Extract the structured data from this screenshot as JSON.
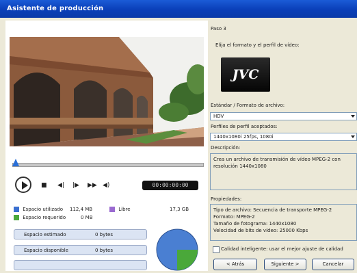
{
  "window": {
    "title": "Asistente de producción"
  },
  "step": {
    "label": "Paso 3",
    "instruction": "Elija el formato y el perfil de vídeo:"
  },
  "logo": {
    "text": "JVC"
  },
  "format": {
    "label": "Estándar / Formato de archivo:",
    "value": "HDV"
  },
  "profile": {
    "label": "Perfiles de perfil aceptados:",
    "value": "1440x1080i 25fps, 1080i"
  },
  "description": {
    "label": "Descripción:",
    "text": "Crea un archivo de transmisión de vídeo MPEG-2 con resolución 1440x1080"
  },
  "properties": {
    "label": "Propiedades:",
    "lines": [
      "Tipo de archivo: Secuencia de transporte MPEG-2",
      "Formato: MPEG-2",
      "Tamaño de fotograma: 1440x1080",
      "Velocidad de bits de vídeo: 25000 Kbps"
    ]
  },
  "checkbox": {
    "label": "Calidad inteligente: usar el mejor ajuste de calidad"
  },
  "player": {
    "timecode": "00:00:00:00"
  },
  "usage": {
    "used_label": "Espacio utilizado",
    "used_value": "112,4 MB",
    "free_label": "Libre",
    "free_value": "17,3 GB",
    "required_label": "Espacio requerido",
    "required_value": "0 MB",
    "rows": [
      {
        "label": "Espacio estimado",
        "value": "0 bytes"
      },
      {
        "label": "Espacio disponible",
        "value": "0 bytes"
      }
    ]
  },
  "pie": {
    "used_color": "#4aa83a",
    "free_color": "#4a7fd2",
    "used_fraction": 0.25
  },
  "colors": {
    "used": "#3a6fd0",
    "free": "#9a6ad0",
    "required": "#4aa83a"
  },
  "buttons": {
    "back": "< Atrás",
    "next": "Siguiente >",
    "cancel": "Cancelar"
  }
}
